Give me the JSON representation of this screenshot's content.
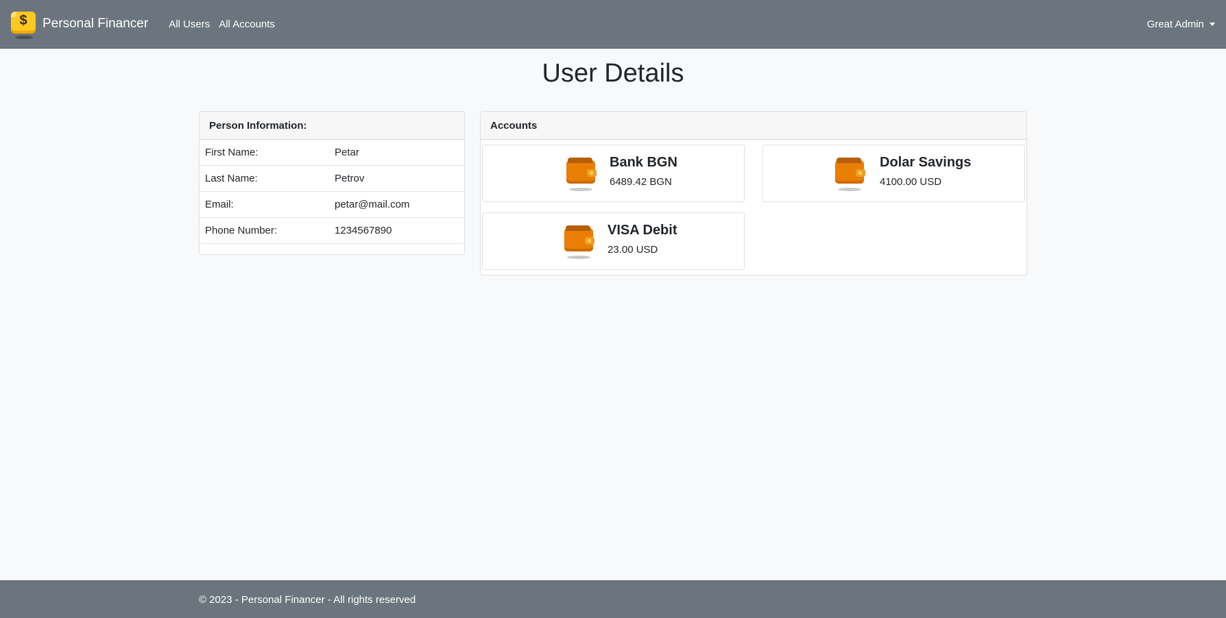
{
  "navbar": {
    "brand": "Personal Financer",
    "brand_icon": "dollar-coin-box-icon",
    "links": [
      "All Users",
      "All Accounts"
    ],
    "user_menu": "Great Admin"
  },
  "page": {
    "title": "User Details"
  },
  "person_info": {
    "header": "Person Information:",
    "rows": [
      {
        "label": "First Name:",
        "value": "Petar"
      },
      {
        "label": "Last Name:",
        "value": "Petrov"
      },
      {
        "label": "Email:",
        "value": "petar@mail.com"
      },
      {
        "label": "Phone Number:",
        "value": "1234567890"
      }
    ]
  },
  "accounts": {
    "header": "Accounts",
    "icon": "wallet-icon",
    "items": [
      {
        "name": "Bank BGN",
        "balance": "6489.42 BGN"
      },
      {
        "name": "Dolar Savings",
        "balance": "4100.00 USD"
      },
      {
        "name": "VISA Debit",
        "balance": "23.00 USD"
      }
    ]
  },
  "footer": {
    "text": "© 2023 - Personal Financer - All rights reserved"
  },
  "colors": {
    "navbar_bg": "#6c757d",
    "page_bg": "#f8f9fa",
    "wallet_orange": "#e87e04",
    "logo_yellow": "#ffc91f"
  }
}
